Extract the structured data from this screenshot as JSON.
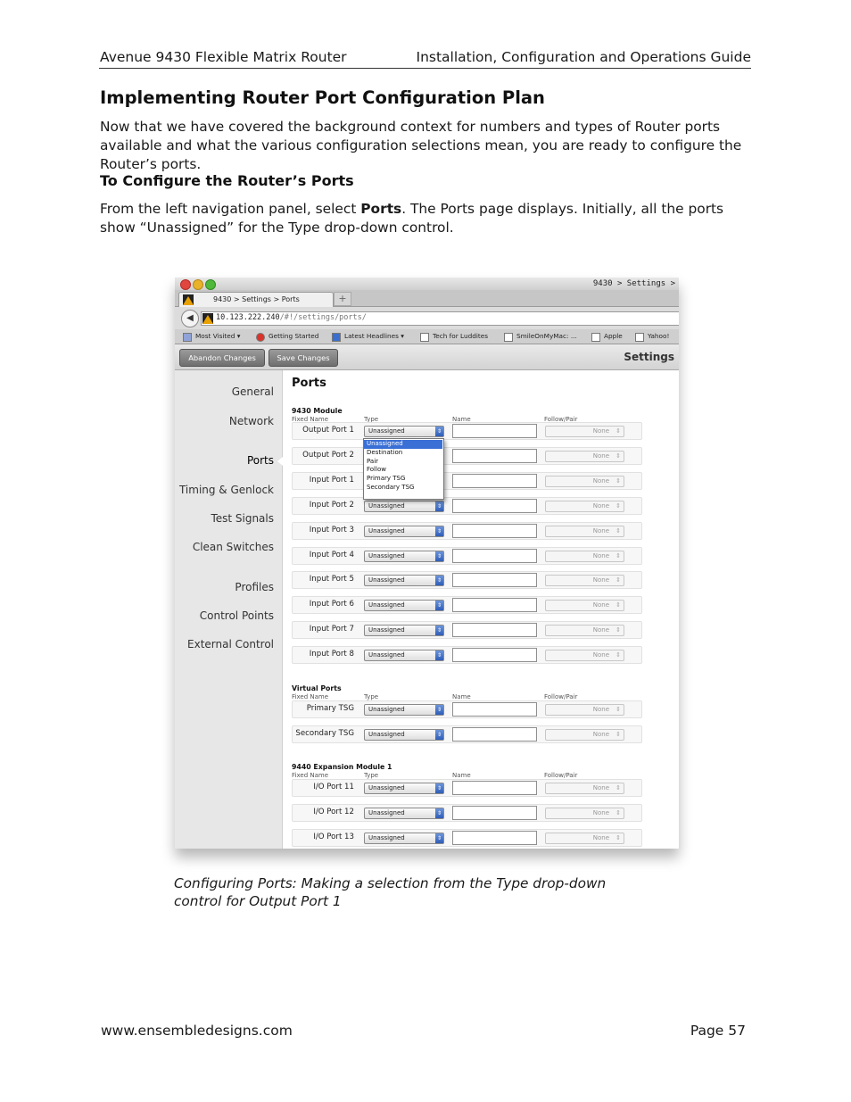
{
  "page_header": {
    "left": "Avenue 9430 Flexible Matrix Router",
    "right": "Installation, Configuration and Operations Guide"
  },
  "section_title": "Implementing Router Port Configuration Plan",
  "intro_paragraph": "Now that we have covered the background context for numbers and types of Router ports available and what the various configuration selections mean, you are ready to configure the Router’s ports.",
  "subsection_title": "To Configure the Router’s Ports",
  "instruction": {
    "before": "From the left navigation panel, select ",
    "bold": "Ports",
    "after": ". The Ports page displays. Initially, all the ports show “Unassigned” for the Type drop-down control."
  },
  "screenshot": {
    "window_title": "9430 > Settings >",
    "tab_title": "9430 > Settings > Ports",
    "tab_plus": "+",
    "url_host": "10.123.222.240",
    "url_path": "/#!/settings/ports/",
    "bookmarks": [
      "Most Visited ▾",
      "Getting Started",
      "Latest Headlines ▾",
      "Tech for Luddites",
      "SmileOnMyMac: ...",
      "Apple",
      "Yahoo!"
    ],
    "buttons": {
      "abandon": "Abandon Changes",
      "save": "Save Changes"
    },
    "settings_title": "Settings",
    "nav_items": [
      "General",
      "Network",
      "Ports",
      "Timing & Genlock",
      "Test Signals",
      "Clean Switches",
      "Profiles",
      "Control Points",
      "External Control"
    ],
    "selected_nav": "Ports",
    "page_title": "Ports",
    "columns": {
      "fixed_name": "Fixed Name",
      "type": "Type",
      "name": "Name",
      "follow": "Follow/Pair"
    },
    "groups": [
      {
        "title": "9430 Module",
        "ports": [
          "Output Port 1",
          "Output Port 2",
          "Input Port 1",
          "Input Port 2",
          "Input Port 3",
          "Input Port 4",
          "Input Port 5",
          "Input Port 6",
          "Input Port 7",
          "Input Port 8"
        ]
      },
      {
        "title": "Virtual Ports",
        "ports": [
          "Primary TSG",
          "Secondary TSG"
        ]
      },
      {
        "title": "9440 Expansion Module 1",
        "ports": [
          "I/O Port 11",
          "I/O Port 12",
          "I/O Port 13"
        ]
      }
    ],
    "type_default": "Unassigned",
    "follow_default": "None",
    "dropdown_options": [
      "Unassigned",
      "Destination",
      "Pair",
      "Follow",
      "Primary TSG",
      "Secondary TSG"
    ],
    "dropdown_highlight": "Unassigned"
  },
  "caption": "Configuring Ports: Making a selection from the Type drop-down control for Output Port 1",
  "footer": {
    "left": "www.ensembledesigns.com",
    "right": "Page 57"
  },
  "colors": {
    "accent_blue": "#3a6fd6",
    "warning_orange": "#e8a100"
  }
}
